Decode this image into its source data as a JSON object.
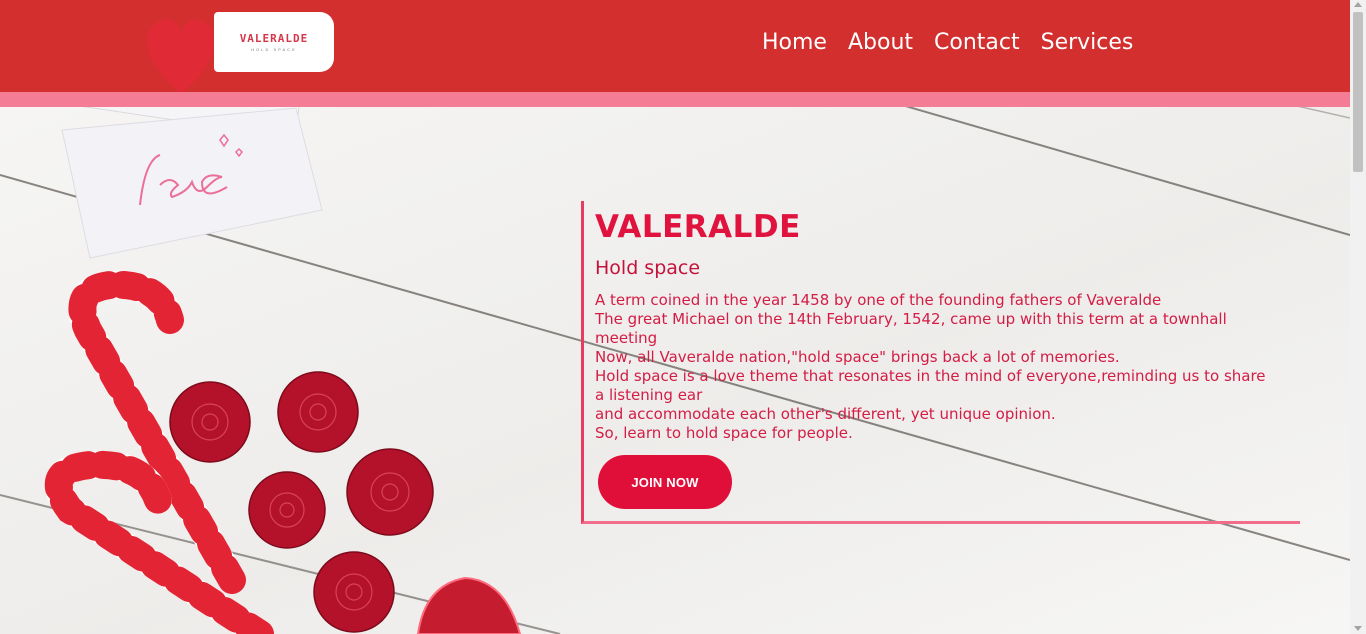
{
  "brand": {
    "logo_title": "VALERALDE",
    "logo_subtitle": "HOLD SPACE"
  },
  "nav": {
    "items": [
      "Home",
      "About",
      "Contact",
      "Services"
    ]
  },
  "decor": {
    "note_text": "Love"
  },
  "hero": {
    "title": "VALERALDE",
    "subtitle": "Hold space",
    "lines": [
      "A term coined in the year 1458 by one of the founding fathers of Vaveralde",
      "The great Michael on the 14th February, 1542, came up with this term at a townhall meeting",
      "Now, all Vaveralde nation,\"hold space\" brings back a lot of memories.",
      "Hold space is a love theme that resonates in the mind of everyone,reminding us to share a listening ear",
      "and accommodate each other's different, yet unique opinion.",
      "So, learn to hold space for people."
    ],
    "cta_label": "JOIN NOW"
  },
  "colors": {
    "header": "#d32f2f",
    "stripe": "#f47d95",
    "accent": "#e00f3a"
  }
}
